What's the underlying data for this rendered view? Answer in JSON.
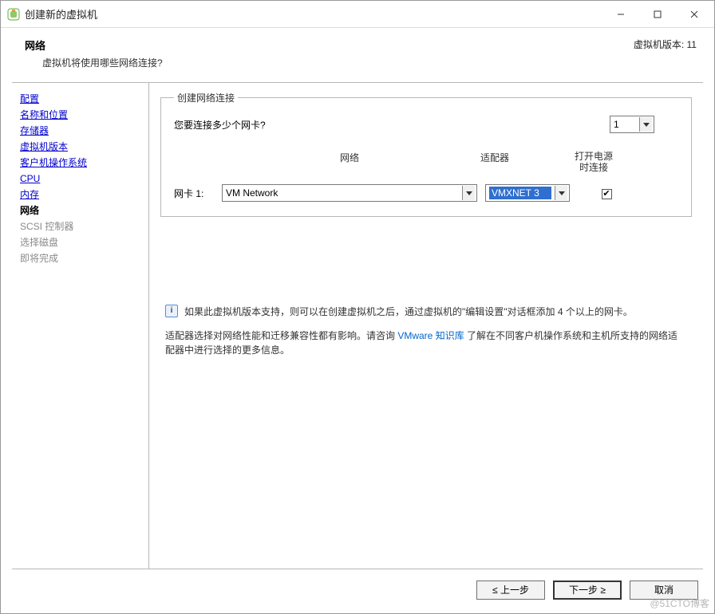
{
  "window": {
    "title": "创建新的虚拟机"
  },
  "header": {
    "title": "网络",
    "subtitle": "虚拟机将使用哪些网络连接?",
    "version_label": "虚拟机版本: 11"
  },
  "sidebar": {
    "items": [
      {
        "label": "配置",
        "state": "link"
      },
      {
        "label": "名称和位置",
        "state": "link"
      },
      {
        "label": "存储器",
        "state": "link"
      },
      {
        "label": "虚拟机版本",
        "state": "link"
      },
      {
        "label": "客户机操作系统",
        "state": "link"
      },
      {
        "label": "CPU",
        "state": "link"
      },
      {
        "label": "内存",
        "state": "link"
      },
      {
        "label": "网络",
        "state": "current"
      },
      {
        "label": "SCSI 控制器",
        "state": "disabled"
      },
      {
        "label": "选择磁盘",
        "state": "disabled"
      },
      {
        "label": "即将完成",
        "state": "disabled"
      }
    ]
  },
  "group": {
    "legend": "创建网络连接",
    "question": "您要连接多少个网卡?",
    "nic_count": "1",
    "columns": {
      "network": "网络",
      "adapter": "适配器",
      "power_on": "打开电源时连接"
    },
    "nic1": {
      "label": "网卡 1:",
      "network": "VM Network",
      "adapter": "VMXNET 3",
      "connect_checked": true
    }
  },
  "info": {
    "tip1": "如果此虚拟机版本支持，则可以在创建虚拟机之后，通过虚拟机的\"编辑设置\"对话框添加 4 个以上的网卡。",
    "tip2_pre": "适配器选择对网络性能和迁移兼容性都有影响。请咨询 ",
    "kb_link": "VMware 知识库",
    "tip2_post": " 了解在不同客户机操作系统和主机所支持的网络适配器中进行选择的更多信息。"
  },
  "footer": {
    "back": "≤ 上一步",
    "next": "下一步 ≥",
    "cancel": "取消"
  },
  "watermark": "@51CTO博客"
}
